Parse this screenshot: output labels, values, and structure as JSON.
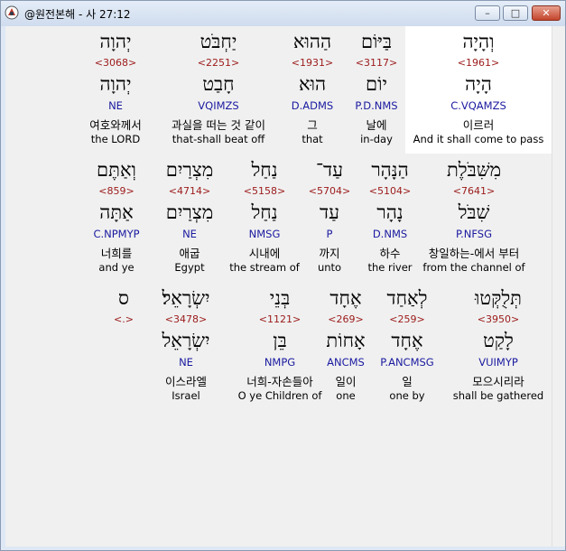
{
  "window": {
    "title": "@원전본해 - 사 27:12"
  },
  "controls": {
    "min": "–",
    "max": "□",
    "close": "✕"
  },
  "rows": [
    [
      {
        "heb": "וְהָיָה",
        "strong": "<1961>",
        "lemma": "הָיָה",
        "parse": "C.VQAMZS",
        "kor": "이르러",
        "eng": "And it shall come to pass"
      },
      {
        "heb": "בַּיּוֹם",
        "strong": "<3117>",
        "lemma": "יוֹם",
        "parse": "P.D.NMS",
        "kor": "날에",
        "eng": "in-day"
      },
      {
        "heb": "הַהוּא",
        "strong": "<1931>",
        "lemma": "הוּא",
        "parse": "D.ADMS",
        "kor": "그",
        "eng": "that"
      },
      {
        "heb": "יַחְבֹּט",
        "strong": "<2251>",
        "lemma": "חָבַט",
        "parse": "VQIMZS",
        "kor": "과실을 떠는 것 같이",
        "eng": "that-shall beat off"
      },
      {
        "heb": "יְהוָה",
        "strong": "<3068>",
        "lemma": "יְהוָה",
        "parse": "NE",
        "kor": "여호와께서",
        "eng": "the LORD"
      }
    ],
    [
      {
        "heb": "מִשִּׁבֹּלֶת",
        "strong": "<7641>",
        "lemma": "שִׁבֹּל",
        "parse": "P.NFSG",
        "kor": "창일하는-에서 부터",
        "eng": "from the channel of"
      },
      {
        "heb": "הַנָּהָר",
        "strong": "<5104>",
        "lemma": "נָהָר",
        "parse": "D.NMS",
        "kor": "하수",
        "eng": "the river"
      },
      {
        "heb": "עַד־",
        "strong": "<5704>",
        "lemma": "עַד",
        "parse": "P",
        "kor": "까지",
        "eng": "unto"
      },
      {
        "heb": "נַחַל",
        "strong": "<5158>",
        "lemma": "נַחַל",
        "parse": "NMSG",
        "kor": "시내에",
        "eng": "the stream of"
      },
      {
        "heb": "מִצְרַיִם",
        "strong": "<4714>",
        "lemma": "מִצְרַיִם",
        "parse": "NE",
        "kor": "애굽",
        "eng": "Egypt"
      },
      {
        "heb": "וְאַתֶּם",
        "strong": "<859>",
        "lemma": "אַתָּה",
        "parse": "C.NPMYP",
        "kor": "너희를",
        "eng": "and ye"
      }
    ],
    [
      {
        "heb": "תְּלֻקְּטוּ",
        "strong": "<3950>",
        "lemma": "לָקַט",
        "parse": "VUIMYP",
        "kor": "모으시리라",
        "eng": "shall be gathered"
      },
      {
        "heb": "לְאַחַד",
        "strong": "<259>",
        "lemma": "אֶחָד",
        "parse": "P.ANCMSG",
        "kor": "일",
        "eng": "one by"
      },
      {
        "heb": "אֶחָד",
        "strong": "<269>",
        "lemma": "אָחוֹת",
        "parse": "ANCMS",
        "kor": "일이",
        "eng": "one"
      },
      {
        "heb": "בְּנֵי",
        "strong": "<1121>",
        "lemma": "בֵּן",
        "parse": "NMPG",
        "kor": "너희-자손들아",
        "eng": "O ye Children of"
      },
      {
        "heb": "יִשְׂרָאֵל׃",
        "strong": "<3478>",
        "lemma": "יִשְׂרָאֵל",
        "parse": "NE",
        "kor": "이스라엘",
        "eng": "Israel"
      },
      {
        "heb": "ס",
        "strong": "<.>",
        "lemma": "",
        "parse": "",
        "kor": "",
        "eng": ""
      }
    ]
  ]
}
